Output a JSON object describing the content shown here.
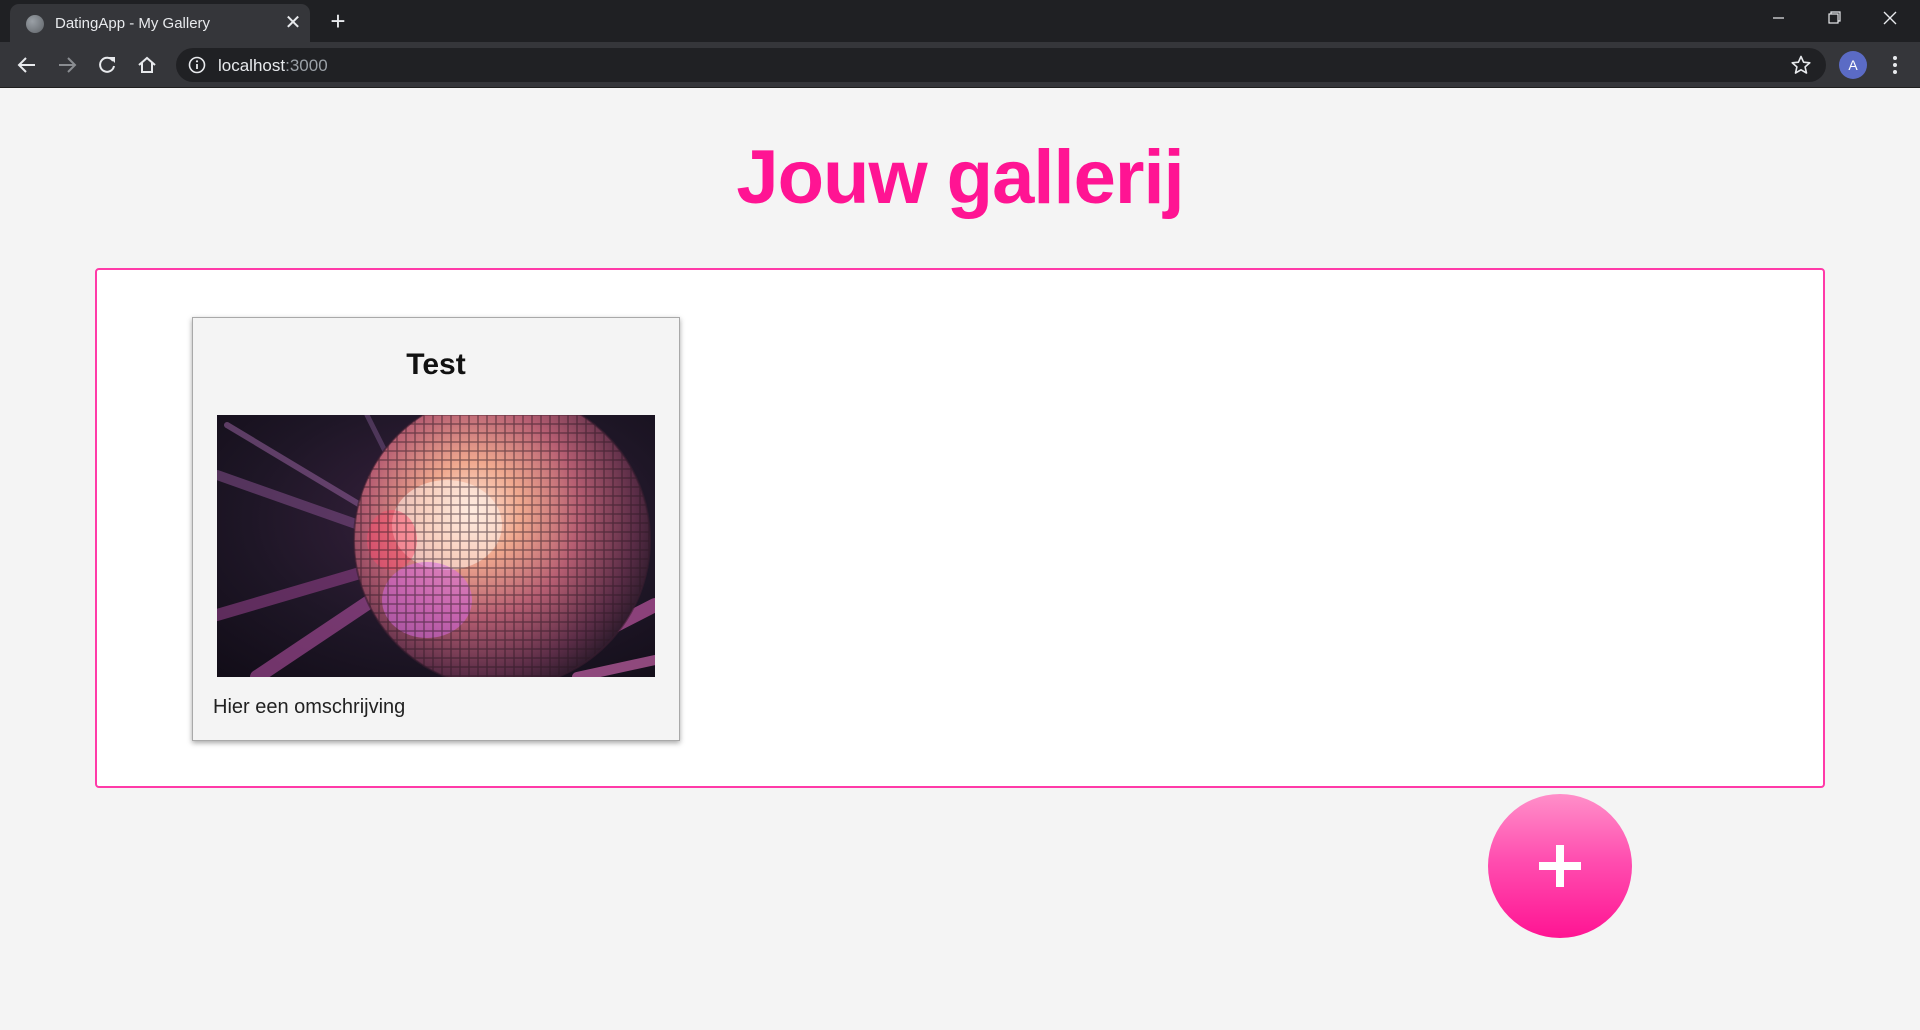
{
  "browser": {
    "tab_title": "DatingApp - My Gallery",
    "tab_close": "✕",
    "new_tab": "+",
    "url_host": "localhost",
    "url_port": ":3000",
    "profile_initial": "A"
  },
  "page": {
    "title": "Jouw gallerij"
  },
  "gallery": {
    "items": [
      {
        "title": "Test",
        "description": "Hier een omschrijving"
      }
    ]
  },
  "icons": {
    "back": "arrow-left-icon",
    "forward": "arrow-right-icon",
    "reload": "reload-icon",
    "home": "home-icon",
    "info": "info-icon",
    "star": "star-icon",
    "menu": "kebab-menu-icon",
    "add": "plus-icon"
  },
  "colors": {
    "accent": "#ff1493",
    "border": "#ff3aa8"
  }
}
